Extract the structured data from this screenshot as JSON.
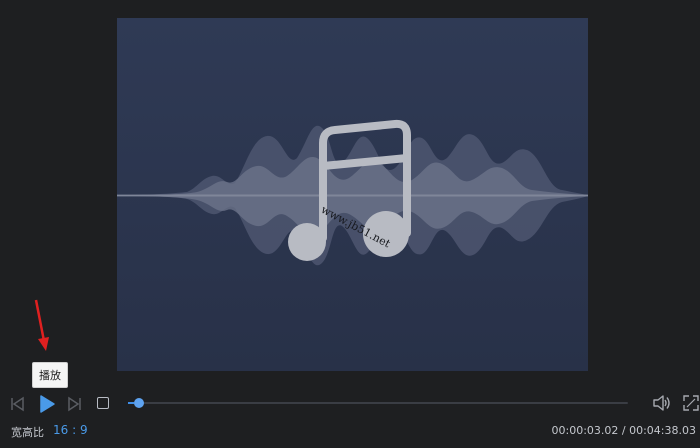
{
  "preview": {
    "watermark": "www.jb51.net",
    "background": "#2c3550",
    "icon": "music-note-icon"
  },
  "tooltip": {
    "text": "播放"
  },
  "controls": {
    "prev_icon": "skip-back-icon",
    "play_icon": "play-icon",
    "next_icon": "skip-forward-icon",
    "stop_icon": "stop-icon",
    "volume_icon": "volume-icon",
    "fullscreen_icon": "fullscreen-icon"
  },
  "timeline": {
    "progress": 0.011,
    "accent": "#4a9ae8"
  },
  "status": {
    "aspect_label": "宽高比",
    "aspect_value": "16 : 9",
    "time_display": "00:00:03.02 / 00:04:38.03"
  }
}
